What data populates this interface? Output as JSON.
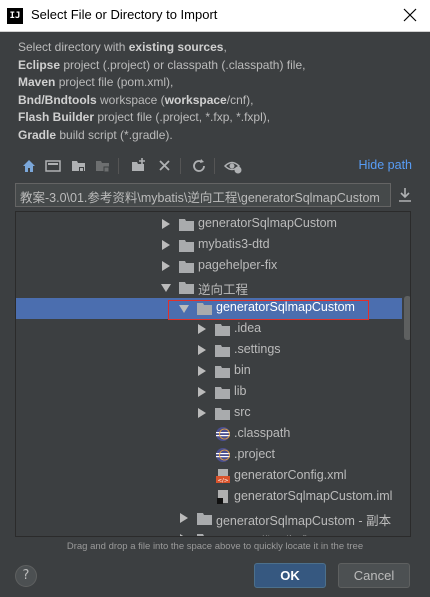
{
  "window": {
    "title": "Select File or Directory to Import",
    "app_icon_text": "IJ"
  },
  "description": {
    "line1_prefix": "Select directory with ",
    "line1_bold": "existing sources",
    "line1_suffix": ",",
    "line2_bold": "Eclipse",
    "line2_suffix": " project (.project) or classpath (.classpath) file,",
    "line3_bold": "Maven",
    "line3_suffix": " project file (pom.xml),",
    "line4_bold1": "Bnd/Bndtools",
    "line4_mid": " workspace (",
    "line4_bold2": "workspace",
    "line4_suffix": "/cnf),",
    "line5_bold": "Flash Builder",
    "line5_suffix": " project file (.project, *.fxp, *.fxpl),",
    "line6_bold": "Gradle",
    "line6_suffix": " build script (*.gradle)."
  },
  "toolbar": {
    "icons": [
      "home-icon",
      "desktop-icon",
      "project-folder-icon",
      "module-folder-icon",
      "new-folder-icon",
      "delete-icon",
      "refresh-icon",
      "show-hidden-icon"
    ],
    "hide_path_label": "Hide path"
  },
  "path": {
    "value": "教案-3.0\\01.参考资料\\mybatis\\逆向工程\\generatorSqlmapCustom"
  },
  "tree": {
    "items": [
      {
        "label": "generatorSqlmapCustom",
        "type": "folder",
        "expanded": false
      },
      {
        "label": "mybatis3-dtd",
        "type": "folder",
        "expanded": false
      },
      {
        "label": "pagehelper-fix",
        "type": "folder",
        "expanded": false
      },
      {
        "label": "逆向工程",
        "type": "folder",
        "expanded": true
      },
      {
        "label": "generatorSqlmapCustom",
        "type": "folder",
        "expanded": true,
        "selected": true
      },
      {
        "label": ".idea",
        "type": "folder",
        "expanded": false
      },
      {
        "label": ".settings",
        "type": "folder",
        "expanded": false
      },
      {
        "label": "bin",
        "type": "folder",
        "expanded": false
      },
      {
        "label": "lib",
        "type": "folder",
        "expanded": false
      },
      {
        "label": "src",
        "type": "folder",
        "expanded": false
      },
      {
        "label": ".classpath",
        "type": "eclipse-file"
      },
      {
        "label": ".project",
        "type": "eclipse-file"
      },
      {
        "label": "generatorConfig.xml",
        "type": "xml-file"
      },
      {
        "label": "generatorSqlmapCustom.iml",
        "type": "iml-file"
      },
      {
        "label": "generatorSqlmapCustom - 副本",
        "type": "folder",
        "expanded": false
      },
      {
        "label": "mybatis代码生成",
        "type": "folder",
        "expanded": false
      }
    ]
  },
  "hint": "Drag and drop a file into the space above to quickly locate it in the tree",
  "buttons": {
    "help": "?",
    "ok": "OK",
    "cancel": "Cancel"
  },
  "colors": {
    "background": "#3c3f41",
    "selection": "#4b6eaf",
    "link": "#589df6",
    "highlight_border": "#e0302b",
    "ok_button": "#365880"
  }
}
